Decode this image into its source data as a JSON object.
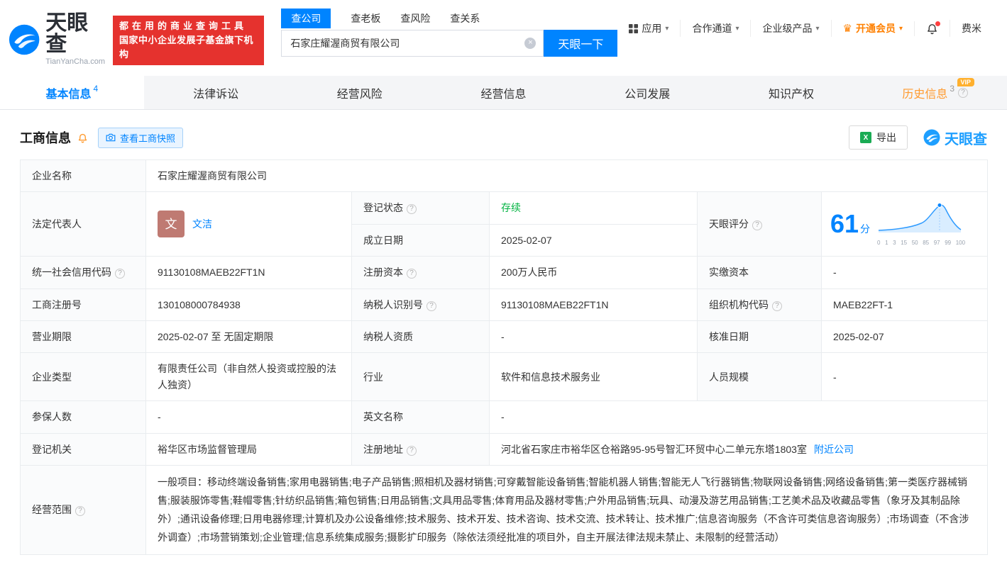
{
  "colors": {
    "primary_blue": "#0084ff",
    "banner_red": "#e5322e",
    "history_orange": "#ff9a2e",
    "member_orange": "#ff8000",
    "status_green": "#00b340",
    "excel_green": "#1aab54"
  },
  "icons": {
    "help": "?",
    "clear": "×",
    "caret_down": "▾",
    "crown": "♛",
    "excel": "X"
  },
  "header": {
    "logo_text": "天眼查",
    "logo_domain": "TianYanCha.com",
    "slogan_line1": "都在用的商业查询工具",
    "slogan_line2": "国家中小企业发展子基金旗下机构",
    "search_tabs": [
      {
        "label": "查公司"
      },
      {
        "label": "查老板"
      },
      {
        "label": "查风险"
      },
      {
        "label": "查关系"
      }
    ],
    "search_value": "石家庄耀渥商贸有限公司",
    "search_button": "天眼一下",
    "nav_app": "应用",
    "nav_partner": "合作通道",
    "nav_enterprise": "企业级产品",
    "nav_vip": "开通会员",
    "nav_user": "费米"
  },
  "tabs": [
    {
      "label": "基本信息",
      "badge": "4"
    },
    {
      "label": "法律诉讼"
    },
    {
      "label": "经营风险"
    },
    {
      "label": "经营信息"
    },
    {
      "label": "公司发展"
    },
    {
      "label": "知识产权"
    },
    {
      "label": "历史信息",
      "badge": "3",
      "vip_tag": "VIP"
    }
  ],
  "section": {
    "title": "工商信息",
    "snapshot_button": "查看工商快照",
    "export_button": "导出",
    "brand_watermark": "天眼查"
  },
  "fields": {
    "company_name_label": "企业名称",
    "company_name": "石家庄耀渥商贸有限公司",
    "legal_rep_label": "法定代表人",
    "legal_rep_avatar": "文",
    "legal_rep_name": "文洁",
    "reg_status_label": "登记状态",
    "reg_status": "存续",
    "establish_date_label": "成立日期",
    "establish_date": "2025-02-07",
    "score_label": "天眼评分",
    "score_value": "61",
    "score_unit": "分",
    "credit_code_label": "统一社会信用代码",
    "credit_code": "91130108MAEB22FT1N",
    "reg_capital_label": "注册资本",
    "reg_capital": "200万人民币",
    "paid_capital_label": "实缴资本",
    "paid_capital": "-",
    "reg_number_label": "工商注册号",
    "reg_number": "130108000784938",
    "taxpayer_id_label": "纳税人识别号",
    "taxpayer_id": "91130108MAEB22FT1N",
    "org_code_label": "组织机构代码",
    "org_code": "MAEB22FT-1",
    "business_term_label": "营业期限",
    "business_term": "2025-02-07 至 无固定期限",
    "taxpayer_quality_label": "纳税人资质",
    "taxpayer_quality": "-",
    "approval_date_label": "核准日期",
    "approval_date": "2025-02-07",
    "company_type_label": "企业类型",
    "company_type": "有限责任公司（非自然人投资或控股的法人独资）",
    "industry_label": "行业",
    "industry": "软件和信息技术服务业",
    "staff_size_label": "人员规模",
    "staff_size": "-",
    "insured_label": "参保人数",
    "insured": "-",
    "english_name_label": "英文名称",
    "english_name": "-",
    "reg_authority_label": "登记机关",
    "reg_authority": "裕华区市场监督管理局",
    "reg_address_label": "注册地址",
    "reg_address": "河北省石家庄市裕华区仓裕路95-95号智汇环贸中心二单元东塔1803室",
    "nearby_link": "附近公司",
    "business_scope_label": "经营范围",
    "business_scope": "一般项目：移动终端设备销售;家用电器销售;电子产品销售;照相机及器材销售;可穿戴智能设备销售;智能机器人销售;智能无人飞行器销售;物联网设备销售;网络设备销售;第一类医疗器械销售;服装服饰零售;鞋帽零售;针纺织品销售;箱包销售;日用品销售;文具用品零售;体育用品及器材零售;户外用品销售;玩具、动漫及游艺用品销售;工艺美术品及收藏品零售（象牙及其制品除外）;通讯设备修理;日用电器修理;计算机及办公设备维修;技术服务、技术开发、技术咨询、技术交流、技术转让、技术推广;信息咨询服务（不含许可类信息咨询服务）;市场调查（不含涉外调查）;市场营销策划;企业管理;信息系统集成服务;摄影扩印服务（除依法须经批准的项目外，自主开展法律法规未禁止、未限制的经营活动）"
  },
  "score_chart": {
    "type": "area",
    "axis_labels": [
      "0",
      "1",
      "3",
      "15",
      "50",
      "85",
      "97",
      "99",
      "100"
    ]
  }
}
